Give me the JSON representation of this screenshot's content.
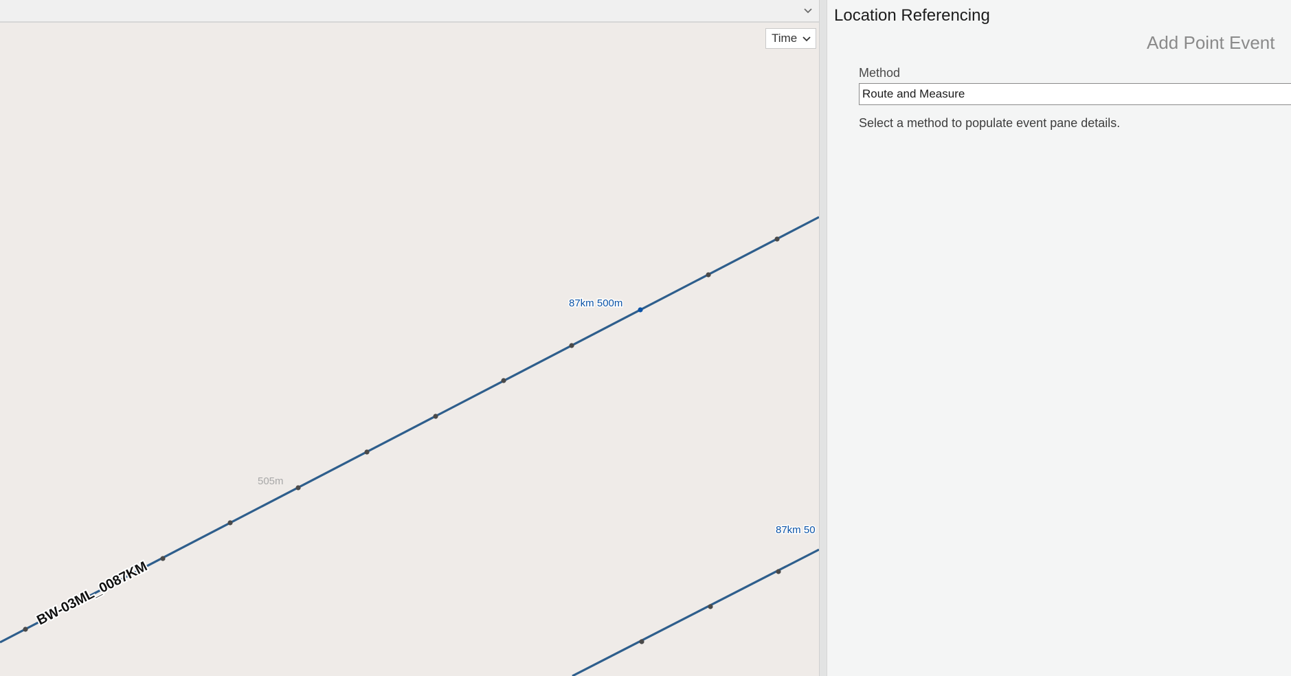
{
  "map": {
    "time_control": {
      "label": "Time"
    },
    "labels": {
      "route_name": "BW-03ML_0087KM",
      "measure_a": "87km 500m",
      "measure_b": "87km 50",
      "minor_measure": "505m"
    },
    "colors": {
      "route_line": "#2e5e8c",
      "vertex": "#4a4a4a",
      "measure_text": "#0a52a6",
      "background": "#efebe8"
    }
  },
  "pane": {
    "title": "Location Referencing",
    "subtitle": "Add Point Event",
    "method": {
      "label": "Method",
      "value": "Route and Measure",
      "hint": "Select a method to populate event pane details."
    }
  }
}
